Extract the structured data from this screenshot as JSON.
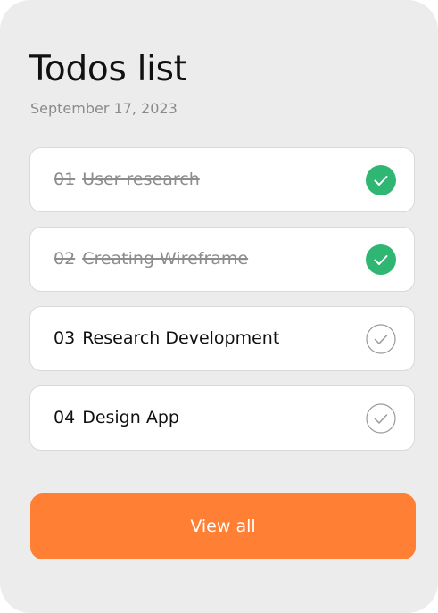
{
  "header": {
    "title": "Todos list",
    "date": "September 17, 2023"
  },
  "todos": [
    {
      "number": "01",
      "text": "User research",
      "completed": true
    },
    {
      "number": "02",
      "text": "Creating Wireframe",
      "completed": true
    },
    {
      "number": "03",
      "text": "Research Development",
      "completed": false
    },
    {
      "number": "04",
      "text": "Design App",
      "completed": false
    }
  ],
  "icons": {
    "completed": "check-circle-filled-icon",
    "pending": "check-circle-outline-icon"
  },
  "colors": {
    "card_background": "#ececec",
    "completed_check": "#2fb673",
    "pending_check": "#9a9a9a",
    "accent_button": "#ff7f34"
  },
  "actions": {
    "view_all_label": "View all"
  }
}
